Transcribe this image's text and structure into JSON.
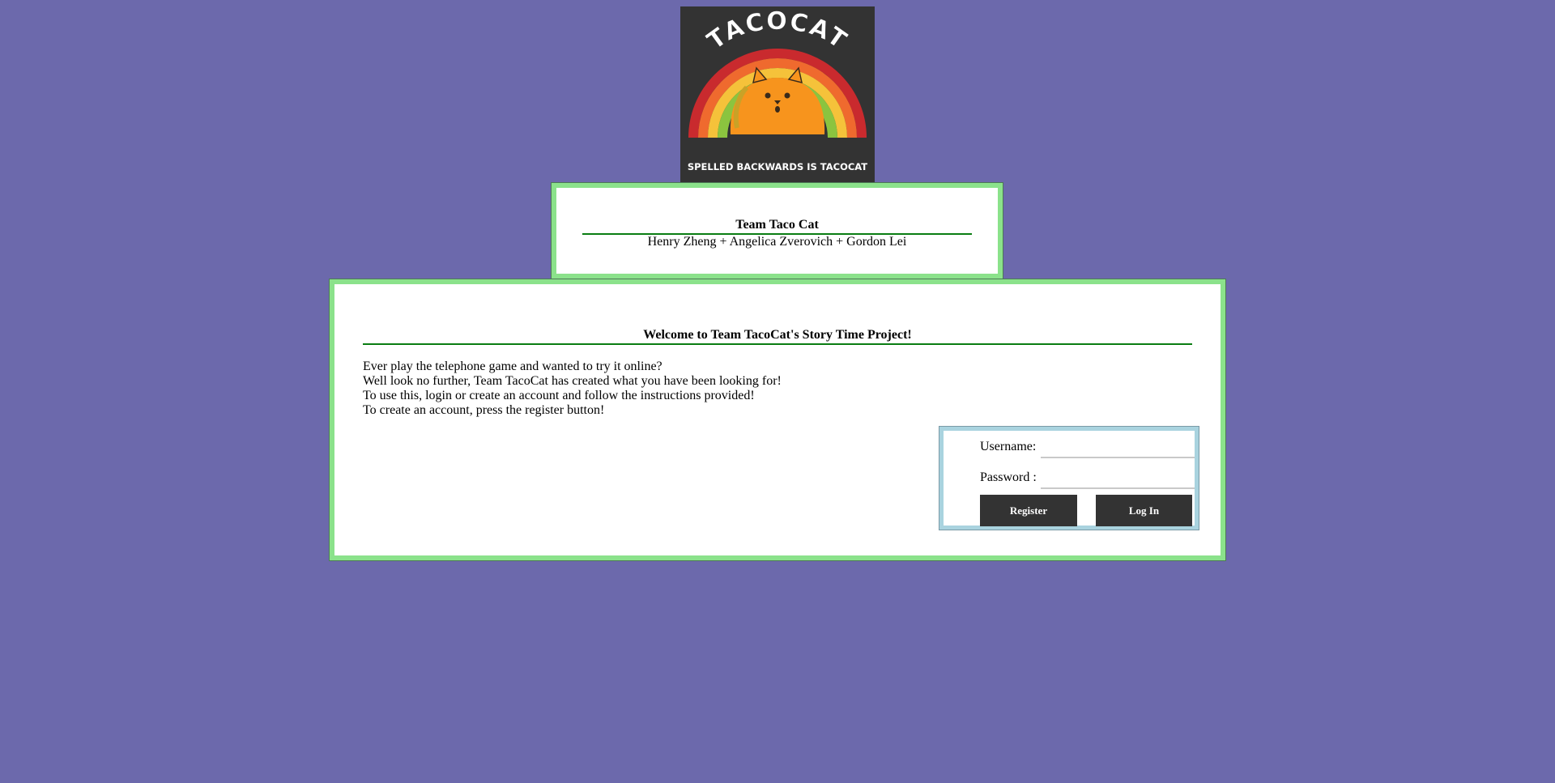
{
  "logo": {
    "top_text": "TACOCAT",
    "bottom_text": "SPELLED BACKWARDS IS TACOCAT",
    "rainbow_colors": [
      "#c92a2e",
      "#ef6a2e",
      "#f5c23a",
      "#8bc43f"
    ],
    "cat_color": "#f7941d"
  },
  "credits": {
    "title": "Team Taco Cat",
    "names": "Henry Zheng + Angelica Zverovich + Gordon Lei"
  },
  "welcome": {
    "title": "Welcome to Team TacoCat's Story Time Project!",
    "lines": [
      "Ever play the telephone game and wanted to try it online?",
      "Well look no further, Team TacoCat has created what you have been looking for!",
      "To use this, login or create an account and follow the instructions provided!",
      "To create an account, press the register button!"
    ]
  },
  "login": {
    "username_label": "Username:",
    "password_label": "Password :",
    "username_value": "",
    "password_value": "",
    "register_label": "Register",
    "login_label": "Log In"
  },
  "colors": {
    "background": "#6c69ac",
    "box_border": "#8be28b",
    "underline": "#0a7d12",
    "login_border": "#a9d3df",
    "button": "#333333"
  }
}
